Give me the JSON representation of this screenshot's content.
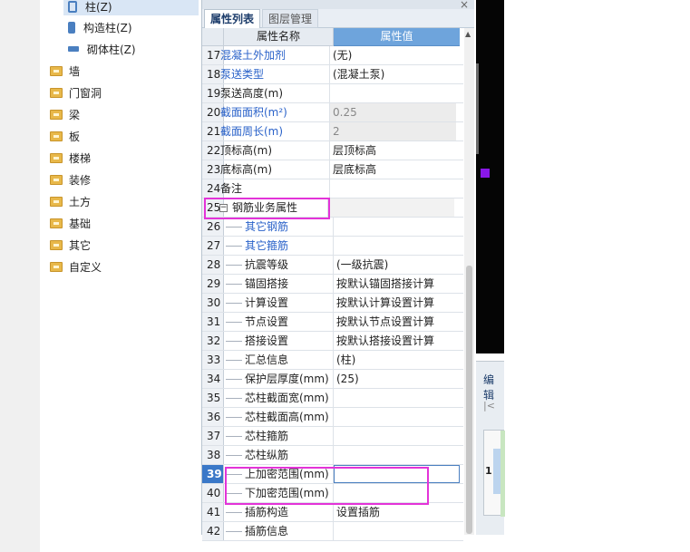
{
  "tree": {
    "children": [
      {
        "label": "柱(Z)",
        "icon": "column-icon"
      },
      {
        "label": "构造柱(Z)",
        "icon": "structural-column-icon"
      },
      {
        "label": "砌体柱(Z)",
        "icon": "masonry-column-icon"
      }
    ],
    "folders": [
      "墙",
      "门窗洞",
      "梁",
      "板",
      "楼梯",
      "装修",
      "土方",
      "基础",
      "其它",
      "自定义"
    ]
  },
  "panel": {
    "tabs": [
      "属性列表",
      "图层管理"
    ],
    "close": "×",
    "header": {
      "name": "属性名称",
      "value": "属性值"
    },
    "rows": [
      {
        "num": "17",
        "name": "混凝土外加剂",
        "value": "(无)"
      },
      {
        "num": "18",
        "name": "泵送类型",
        "value": "(混凝土泵)"
      },
      {
        "num": "19",
        "name": "泵送高度(m)",
        "value": ""
      },
      {
        "num": "20",
        "name": "截面面积(m²)",
        "value": "0.25"
      },
      {
        "num": "21",
        "name": "截面周长(m)",
        "value": "2"
      },
      {
        "num": "22",
        "name": "顶标高(m)",
        "value": "层顶标高"
      },
      {
        "num": "23",
        "name": "底标高(m)",
        "value": "层底标高"
      },
      {
        "num": "24",
        "name": "备注",
        "value": ""
      },
      {
        "num": "25",
        "name": "钢筋业务属性",
        "value": ""
      },
      {
        "num": "26",
        "name": "其它钢筋",
        "value": ""
      },
      {
        "num": "27",
        "name": "其它箍筋",
        "value": ""
      },
      {
        "num": "28",
        "name": "抗震等级",
        "value": "(一级抗震)"
      },
      {
        "num": "29",
        "name": "锚固搭接",
        "value": "按默认锚固搭接计算"
      },
      {
        "num": "30",
        "name": "计算设置",
        "value": "按默认计算设置计算"
      },
      {
        "num": "31",
        "name": "节点设置",
        "value": "按默认节点设置计算"
      },
      {
        "num": "32",
        "name": "搭接设置",
        "value": "按默认搭接设置计算"
      },
      {
        "num": "33",
        "name": "汇总信息",
        "value": "(柱)"
      },
      {
        "num": "34",
        "name": "保护层厚度(mm)",
        "value": "(25)"
      },
      {
        "num": "35",
        "name": "芯柱截面宽(mm)",
        "value": ""
      },
      {
        "num": "36",
        "name": "芯柱截面高(mm)",
        "value": ""
      },
      {
        "num": "37",
        "name": "芯柱箍筋",
        "value": ""
      },
      {
        "num": "38",
        "name": "芯柱纵筋",
        "value": ""
      },
      {
        "num": "39",
        "name": "上加密范围(mm)",
        "value": ""
      },
      {
        "num": "40",
        "name": "下加密范围(mm)",
        "value": ""
      },
      {
        "num": "41",
        "name": "插筋构造",
        "value": "设置插筋"
      },
      {
        "num": "42",
        "name": "插筋信息",
        "value": ""
      }
    ]
  },
  "lower_panel": {
    "tab": "编辑",
    "toolbar": "|<",
    "row": "1"
  },
  "colors": {
    "highlight": "#e333d8",
    "header_blue": "#6ea4dc",
    "link_blue": "#2a62c9",
    "marker": "#8a17e8"
  }
}
